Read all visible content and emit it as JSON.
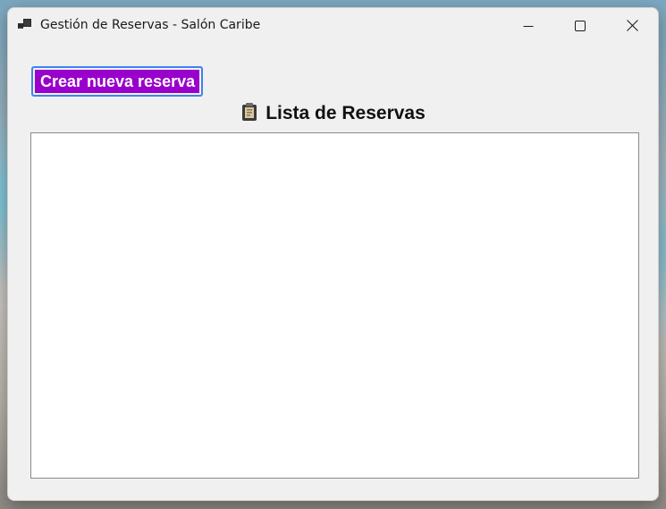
{
  "window": {
    "title": "Gestión de Reservas - Salón Caribe",
    "app_icon": "app-window-icon",
    "controls": {
      "minimize_icon": "minimize-icon",
      "maximize_icon": "maximize-icon",
      "close_icon": "close-icon"
    }
  },
  "main": {
    "create_button_label": "Crear nueva reserva",
    "list_icon": "clipboard-icon",
    "list_title": "Lista de Reservas",
    "reservations": []
  },
  "colors": {
    "button_bg": "#9900cc",
    "button_focus_border": "#3c84f0",
    "window_bg": "#f0f0f0"
  }
}
